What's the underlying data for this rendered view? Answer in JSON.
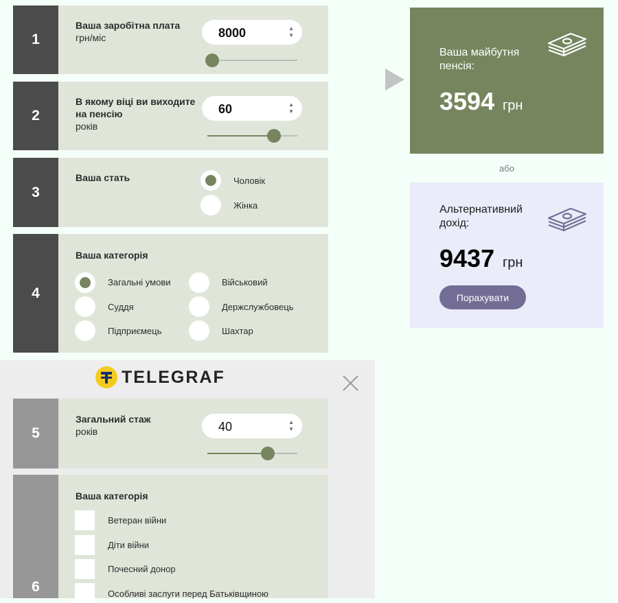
{
  "step1": {
    "number": "1",
    "title": "Ваша заробітна плата",
    "unit": "грн/міс",
    "value": "8000",
    "slider_fraction": 0.05
  },
  "step2": {
    "number": "2",
    "title_line1": "В якому віці ви виходите",
    "title_line2": "на пенсію",
    "unit": "років",
    "value": "60",
    "slider_fraction": 0.74
  },
  "step3": {
    "number": "3",
    "title": "Ваша стать",
    "options": [
      "Чоловік",
      "Жінка"
    ],
    "selected": "Чоловік"
  },
  "step4": {
    "number": "4",
    "title": "Ваша категорія",
    "options": [
      "Загальні умови",
      "Військовий",
      "Суддя",
      "Держслужбовець",
      "Підприємець",
      "Шахтар"
    ],
    "selected": "Загальні умови"
  },
  "step5": {
    "number": "5",
    "title": "Загальний стаж",
    "unit": "років",
    "value": "40",
    "slider_fraction": 0.67
  },
  "step6": {
    "number": "6",
    "title": "Ваша категорія",
    "options": [
      "Ветеран війни",
      "Діти війни",
      "Почесний донор",
      "Особливі заслуги перед Батьківщиною"
    ]
  },
  "pension": {
    "title_line1": "Ваша майбутня",
    "title_line2": "пенсія:",
    "amount": "3594",
    "unit": "грн"
  },
  "or_text": "або",
  "alternative": {
    "title_line1": "Альтернативний",
    "title_line2": "дохід:",
    "amount": "9437",
    "unit": "грн",
    "button": "Порахувати"
  },
  "overlay": {
    "logo_text": "TELEGRAF"
  },
  "icons": {
    "arrow": "play-arrow-icon",
    "money": "money-stack-icon",
    "close": "close-icon",
    "logo": "telegraf-logo-icon"
  },
  "colors": {
    "accent": "#76855e",
    "card": "#e0e5da",
    "number_bg": "#4b4b4b",
    "pension_bg": "#76855e",
    "alt_bg": "#eaecf9",
    "button": "#736c95",
    "logo_yellow": "#f5cc1e"
  }
}
